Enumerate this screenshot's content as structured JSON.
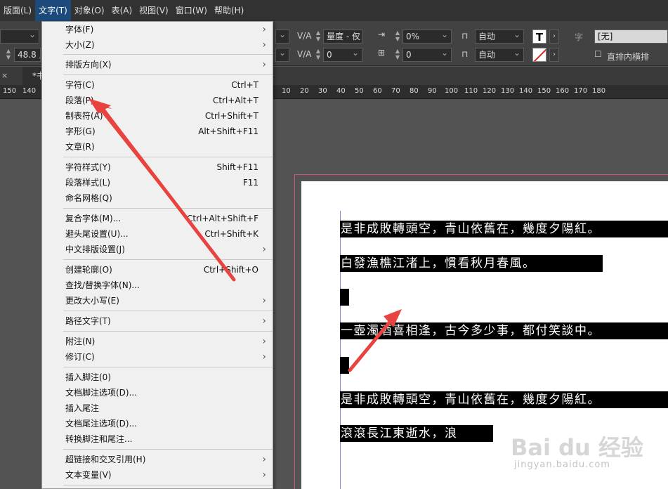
{
  "menubar": {
    "items": [
      {
        "label": "版面(L)"
      },
      {
        "label": "文字(T)"
      },
      {
        "label": "对象(O)"
      },
      {
        "label": "表(A)"
      },
      {
        "label": "视图(V)"
      },
      {
        "label": "窗口(W)"
      },
      {
        "label": "帮助(H)"
      }
    ],
    "active": "文字(T)"
  },
  "controlbar": {
    "font_size_value": "48.8 点",
    "tracking_label": "量度 - 仅",
    "tracking_value": "0",
    "kerning_percent": "0%",
    "baseline_value": "0",
    "auto1": "自动",
    "auto2": "自动",
    "char_style_label": "字",
    "char_style_value": "[无]",
    "vertical_in_horizontal_label": "直排内横排",
    "text_color_label": "T"
  },
  "tab": {
    "label": "*书"
  },
  "ruler": {
    "ticks_left": [
      "150",
      "140"
    ],
    "ticks_right": [
      "10",
      "20",
      "30",
      "40",
      "50",
      "60",
      "70",
      "80",
      "90",
      "100",
      "110",
      "120",
      "130",
      "140",
      "150",
      "160",
      "170",
      "180"
    ]
  },
  "menu": {
    "items": [
      {
        "label": "字体(F)",
        "shortcut": "",
        "submenu": true
      },
      {
        "label": "大小(Z)",
        "shortcut": "",
        "submenu": true
      },
      {
        "label": "排版方向(X)",
        "shortcut": "",
        "submenu": true
      },
      {
        "label": "字符(C)",
        "shortcut": "Ctrl+T",
        "submenu": false
      },
      {
        "label": "段落(P)",
        "shortcut": "Ctrl+Alt+T",
        "submenu": false
      },
      {
        "label": "制表符(A)",
        "shortcut": "Ctrl+Shift+T",
        "submenu": false
      },
      {
        "label": "字形(G)",
        "shortcut": "Alt+Shift+F11",
        "submenu": false
      },
      {
        "label": "文章(R)",
        "shortcut": "",
        "submenu": false
      },
      {
        "label": "字符样式(Y)",
        "shortcut": "Shift+F11",
        "submenu": false
      },
      {
        "label": "段落样式(L)",
        "shortcut": "F11",
        "submenu": false
      },
      {
        "label": "命名网格(Q)",
        "shortcut": "",
        "submenu": false
      },
      {
        "label": "复合字体(M)...",
        "shortcut": "Ctrl+Alt+Shift+F",
        "submenu": false
      },
      {
        "label": "避头尾设置(U)...",
        "shortcut": "Ctrl+Shift+K",
        "submenu": false
      },
      {
        "label": "中文排版设置(J)",
        "shortcut": "",
        "submenu": true
      },
      {
        "label": "创建轮廓(O)",
        "shortcut": "Ctrl+Shift+O",
        "submenu": false
      },
      {
        "label": "查找/替换字体(N)...",
        "shortcut": "",
        "submenu": false
      },
      {
        "label": "更改大小写(E)",
        "shortcut": "",
        "submenu": true
      },
      {
        "label": "路径文字(T)",
        "shortcut": "",
        "submenu": true
      },
      {
        "label": "附注(N)",
        "shortcut": "",
        "submenu": true
      },
      {
        "label": "修订(C)",
        "shortcut": "",
        "submenu": true
      },
      {
        "label": "插入脚注(0)",
        "shortcut": "",
        "submenu": false
      },
      {
        "label": "文档脚注选项(D)...",
        "shortcut": "",
        "submenu": false
      },
      {
        "label": "插入尾注",
        "shortcut": "",
        "submenu": false
      },
      {
        "label": "文档尾注选项(D)...",
        "shortcut": "",
        "submenu": false
      },
      {
        "label": "转换脚注和尾注...",
        "shortcut": "",
        "submenu": false
      },
      {
        "label": "超链接和交叉引用(H)",
        "shortcut": "",
        "submenu": true
      },
      {
        "label": "文本变量(V)",
        "shortcut": "",
        "submenu": true
      }
    ]
  },
  "document": {
    "lines": [
      {
        "text": "是非成敗轉頭空，青山依舊在，幾度夕陽紅。"
      },
      {
        "text": "白發漁樵江渚上，慣看秋月春風。"
      },
      {
        "text": ""
      },
      {
        "text": "一壺濁酒喜相逢，古今多少事，都付笑談中。"
      },
      {
        "text": ""
      },
      {
        "text": "是非成敗轉頭空，青山依舊在，幾度夕陽紅。"
      },
      {
        "text": "滾滾長江東逝水，浪"
      }
    ]
  },
  "watermark": {
    "logo": "Bai du 经验",
    "url": "jingyan.baidu.com"
  },
  "colors": {
    "menu_active_bg": "#1c4a7a",
    "annotation_arrow": "#e8433f",
    "bleed_guide": "#c95a72",
    "text_highlight": "#000000"
  }
}
